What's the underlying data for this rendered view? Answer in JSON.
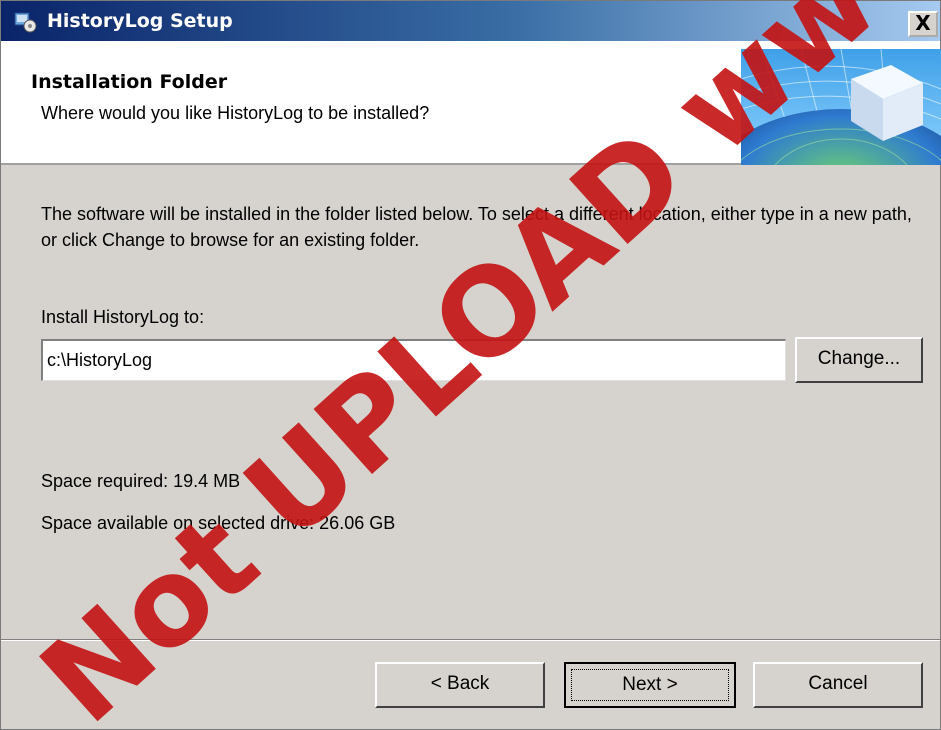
{
  "window": {
    "title": "HistoryLog Setup",
    "close_label": "X"
  },
  "header": {
    "title": "Installation Folder",
    "subtitle": "Where would you like HistoryLog to be installed?"
  },
  "main": {
    "description": "The software will be installed in the folder listed below. To select a different location, either type in a new path, or click Change to browse for an existing folder.",
    "install_label": "Install HistoryLog to:",
    "install_path": "c:\\HistoryLog",
    "change_button": "Change...",
    "space_required": "Space required: 19.4 MB",
    "space_available": "Space available on selected drive: 26.06 GB"
  },
  "footer": {
    "back_button": "< Back",
    "next_button": "Next >",
    "cancel_button": "Cancel"
  },
  "watermark": {
    "text": "Not UPLOAD www.docuta"
  },
  "colors": {
    "titlebar_start": "#0a246a",
    "titlebar_end": "#a6caf0",
    "dialog_bg": "#d6d3ce",
    "watermark": "#c31212"
  }
}
